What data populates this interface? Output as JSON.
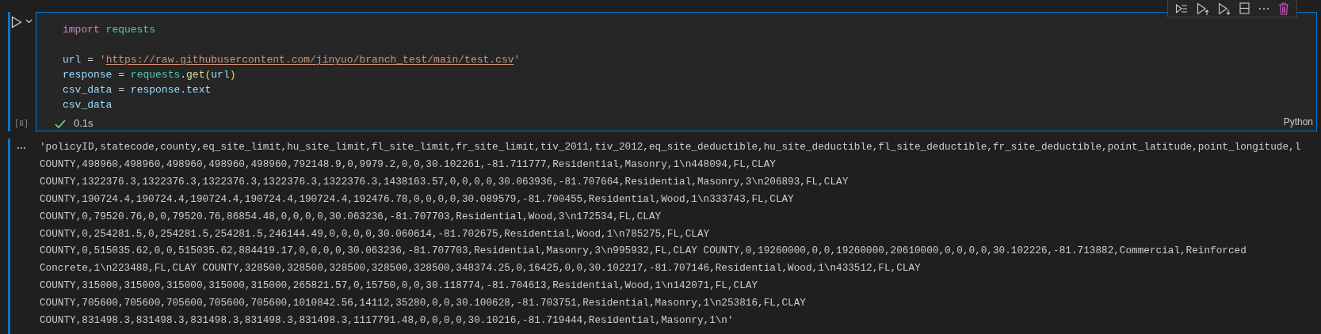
{
  "cell": {
    "selected": true,
    "execution_count": "[8]",
    "language": "Python",
    "code": [
      {
        "kind": "code",
        "tokens": [
          {
            "text": "import ",
            "kind": "keyword"
          },
          {
            "text": "requests",
            "kind": "module"
          }
        ]
      },
      {
        "kind": "blank"
      },
      {
        "kind": "code",
        "tokens": [
          {
            "text": "url",
            "kind": "variable"
          },
          {
            "text": " = ",
            "kind": "plain"
          },
          {
            "text": "'",
            "kind": "string"
          },
          {
            "text": "https://raw.githubusercontent.com/jinyuo/branch_test/main/test.csv",
            "kind": "link"
          },
          {
            "text": "'",
            "kind": "string"
          }
        ]
      },
      {
        "kind": "code",
        "tokens": [
          {
            "text": "response",
            "kind": "variable"
          },
          {
            "text": " = ",
            "kind": "plain"
          },
          {
            "text": "requests",
            "kind": "module"
          },
          {
            "text": ".",
            "kind": "plain"
          },
          {
            "text": "get",
            "kind": "function"
          },
          {
            "text": "(",
            "kind": "bracket"
          },
          {
            "text": "url",
            "kind": "variable"
          },
          {
            "text": ")",
            "kind": "bracket"
          }
        ]
      },
      {
        "kind": "code",
        "tokens": [
          {
            "text": "csv_data",
            "kind": "variable"
          },
          {
            "text": " = ",
            "kind": "plain"
          },
          {
            "text": "response",
            "kind": "variable"
          },
          {
            "text": ".",
            "kind": "plain"
          },
          {
            "text": "text",
            "kind": "variable"
          }
        ]
      },
      {
        "kind": "code",
        "tokens": [
          {
            "text": "csv_data",
            "kind": "variable"
          }
        ]
      }
    ],
    "status": {
      "kind": "success",
      "duration": "0.1s"
    }
  },
  "output": {
    "lines": [
      "'policyID,statecode,county,eq_site_limit,hu_site_limit,fl_site_limit,fr_site_limit,tiv_2011,tiv_2012,eq_site_deductible,hu_site_deductible,fl_site_deductible,fr_site_deductible,point_latitude,point_longitude,l",
      "COUNTY,498960,498960,498960,498960,498960,792148.9,0,9979.2,0,0,30.102261,-81.711777,Residential,Masonry,1\\n448094,FL,CLAY",
      "COUNTY,1322376.3,1322376.3,1322376.3,1322376.3,1322376.3,1438163.57,0,0,0,0,30.063936,-81.707664,Residential,Masonry,3\\n206893,FL,CLAY",
      "COUNTY,190724.4,190724.4,190724.4,190724.4,190724.4,192476.78,0,0,0,0,30.089579,-81.700455,Residential,Wood,1\\n333743,FL,CLAY",
      "COUNTY,0,79520.76,0,0,79520.76,86854.48,0,0,0,0,30.063236,-81.707703,Residential,Wood,3\\n172534,FL,CLAY",
      "COUNTY,0,254281.5,0,254281.5,254281.5,246144.49,0,0,0,0,30.060614,-81.702675,Residential,Wood,1\\n785275,FL,CLAY",
      "COUNTY,0,515035.62,0,0,515035.62,884419.17,0,0,0,0,30.063236,-81.707703,Residential,Masonry,3\\n995932,FL,CLAY COUNTY,0,19260000,0,0,19260000,20610000,0,0,0,0,30.102226,-81.713882,Commercial,Reinforced",
      "Concrete,1\\n223488,FL,CLAY COUNTY,328500,328500,328500,328500,328500,348374.25,0,16425,0,0,30.102217,-81.707146,Residential,Wood,1\\n433512,FL,CLAY",
      "COUNTY,315000,315000,315000,315000,315000,265821.57,0,15750,0,0,30.118774,-81.704613,Residential,Wood,1\\n142071,FL,CLAY",
      "COUNTY,705600,705600,705600,705600,705600,1010842.56,14112,35280,0,0,30.100628,-81.703751,Residential,Masonry,1\\n253816,FL,CLAY",
      "COUNTY,831498.3,831498.3,831498.3,831498.3,831498.3,1117791.48,0,0,0,0,30.10216,-81.719444,Residential,Masonry,1\\n'"
    ]
  }
}
